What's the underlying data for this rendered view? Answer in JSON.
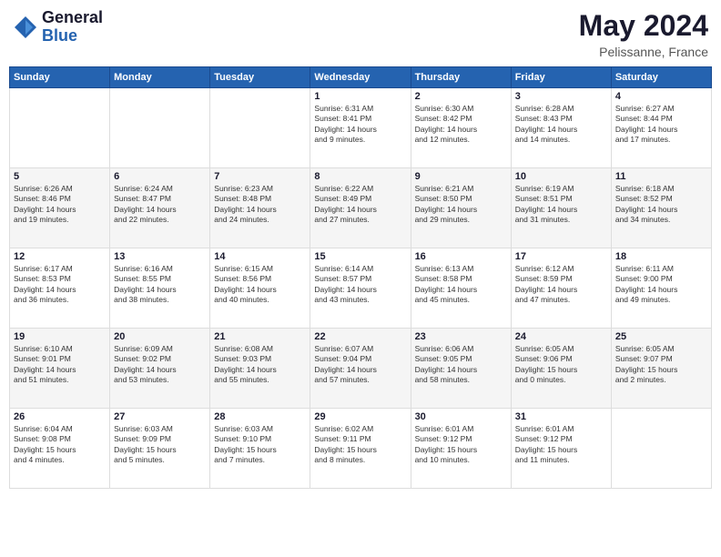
{
  "header": {
    "logo_general": "General",
    "logo_blue": "Blue",
    "month_year": "May 2024",
    "location": "Pelissanne, France"
  },
  "days_of_week": [
    "Sunday",
    "Monday",
    "Tuesday",
    "Wednesday",
    "Thursday",
    "Friday",
    "Saturday"
  ],
  "weeks": [
    [
      {
        "day": "",
        "content": ""
      },
      {
        "day": "",
        "content": ""
      },
      {
        "day": "",
        "content": ""
      },
      {
        "day": "1",
        "content": "Sunrise: 6:31 AM\nSunset: 8:41 PM\nDaylight: 14 hours\nand 9 minutes."
      },
      {
        "day": "2",
        "content": "Sunrise: 6:30 AM\nSunset: 8:42 PM\nDaylight: 14 hours\nand 12 minutes."
      },
      {
        "day": "3",
        "content": "Sunrise: 6:28 AM\nSunset: 8:43 PM\nDaylight: 14 hours\nand 14 minutes."
      },
      {
        "day": "4",
        "content": "Sunrise: 6:27 AM\nSunset: 8:44 PM\nDaylight: 14 hours\nand 17 minutes."
      }
    ],
    [
      {
        "day": "5",
        "content": "Sunrise: 6:26 AM\nSunset: 8:46 PM\nDaylight: 14 hours\nand 19 minutes."
      },
      {
        "day": "6",
        "content": "Sunrise: 6:24 AM\nSunset: 8:47 PM\nDaylight: 14 hours\nand 22 minutes."
      },
      {
        "day": "7",
        "content": "Sunrise: 6:23 AM\nSunset: 8:48 PM\nDaylight: 14 hours\nand 24 minutes."
      },
      {
        "day": "8",
        "content": "Sunrise: 6:22 AM\nSunset: 8:49 PM\nDaylight: 14 hours\nand 27 minutes."
      },
      {
        "day": "9",
        "content": "Sunrise: 6:21 AM\nSunset: 8:50 PM\nDaylight: 14 hours\nand 29 minutes."
      },
      {
        "day": "10",
        "content": "Sunrise: 6:19 AM\nSunset: 8:51 PM\nDaylight: 14 hours\nand 31 minutes."
      },
      {
        "day": "11",
        "content": "Sunrise: 6:18 AM\nSunset: 8:52 PM\nDaylight: 14 hours\nand 34 minutes."
      }
    ],
    [
      {
        "day": "12",
        "content": "Sunrise: 6:17 AM\nSunset: 8:53 PM\nDaylight: 14 hours\nand 36 minutes."
      },
      {
        "day": "13",
        "content": "Sunrise: 6:16 AM\nSunset: 8:55 PM\nDaylight: 14 hours\nand 38 minutes."
      },
      {
        "day": "14",
        "content": "Sunrise: 6:15 AM\nSunset: 8:56 PM\nDaylight: 14 hours\nand 40 minutes."
      },
      {
        "day": "15",
        "content": "Sunrise: 6:14 AM\nSunset: 8:57 PM\nDaylight: 14 hours\nand 43 minutes."
      },
      {
        "day": "16",
        "content": "Sunrise: 6:13 AM\nSunset: 8:58 PM\nDaylight: 14 hours\nand 45 minutes."
      },
      {
        "day": "17",
        "content": "Sunrise: 6:12 AM\nSunset: 8:59 PM\nDaylight: 14 hours\nand 47 minutes."
      },
      {
        "day": "18",
        "content": "Sunrise: 6:11 AM\nSunset: 9:00 PM\nDaylight: 14 hours\nand 49 minutes."
      }
    ],
    [
      {
        "day": "19",
        "content": "Sunrise: 6:10 AM\nSunset: 9:01 PM\nDaylight: 14 hours\nand 51 minutes."
      },
      {
        "day": "20",
        "content": "Sunrise: 6:09 AM\nSunset: 9:02 PM\nDaylight: 14 hours\nand 53 minutes."
      },
      {
        "day": "21",
        "content": "Sunrise: 6:08 AM\nSunset: 9:03 PM\nDaylight: 14 hours\nand 55 minutes."
      },
      {
        "day": "22",
        "content": "Sunrise: 6:07 AM\nSunset: 9:04 PM\nDaylight: 14 hours\nand 57 minutes."
      },
      {
        "day": "23",
        "content": "Sunrise: 6:06 AM\nSunset: 9:05 PM\nDaylight: 14 hours\nand 58 minutes."
      },
      {
        "day": "24",
        "content": "Sunrise: 6:05 AM\nSunset: 9:06 PM\nDaylight: 15 hours\nand 0 minutes."
      },
      {
        "day": "25",
        "content": "Sunrise: 6:05 AM\nSunset: 9:07 PM\nDaylight: 15 hours\nand 2 minutes."
      }
    ],
    [
      {
        "day": "26",
        "content": "Sunrise: 6:04 AM\nSunset: 9:08 PM\nDaylight: 15 hours\nand 4 minutes."
      },
      {
        "day": "27",
        "content": "Sunrise: 6:03 AM\nSunset: 9:09 PM\nDaylight: 15 hours\nand 5 minutes."
      },
      {
        "day": "28",
        "content": "Sunrise: 6:03 AM\nSunset: 9:10 PM\nDaylight: 15 hours\nand 7 minutes."
      },
      {
        "day": "29",
        "content": "Sunrise: 6:02 AM\nSunset: 9:11 PM\nDaylight: 15 hours\nand 8 minutes."
      },
      {
        "day": "30",
        "content": "Sunrise: 6:01 AM\nSunset: 9:12 PM\nDaylight: 15 hours\nand 10 minutes."
      },
      {
        "day": "31",
        "content": "Sunrise: 6:01 AM\nSunset: 9:12 PM\nDaylight: 15 hours\nand 11 minutes."
      },
      {
        "day": "",
        "content": ""
      }
    ]
  ]
}
